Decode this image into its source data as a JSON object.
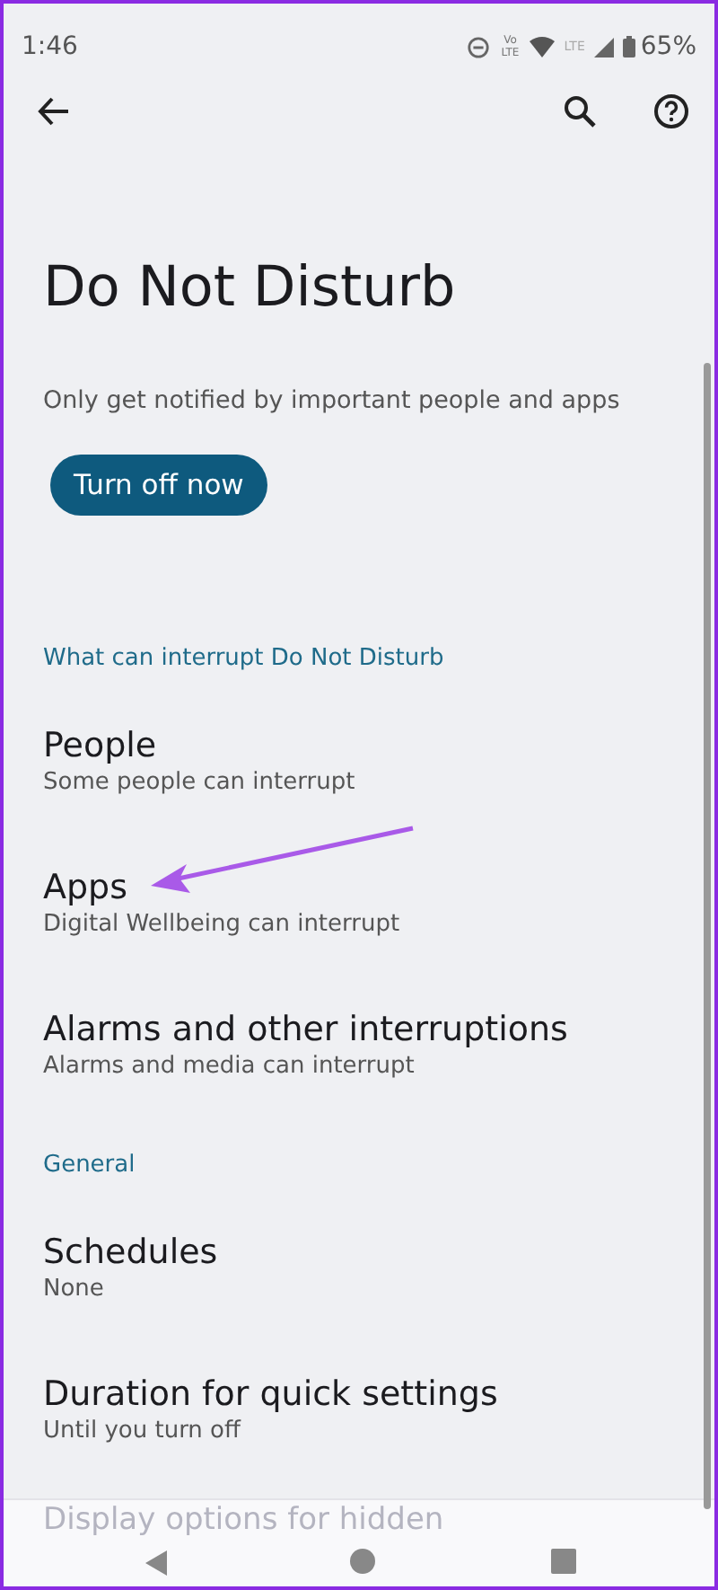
{
  "status_bar": {
    "time": "1:46",
    "network_1": "Vo\nLTE",
    "network_2": "LTE",
    "battery": "65%"
  },
  "title": "Do Not Disturb",
  "description": "Only get notified by important people and apps",
  "action_button": "Turn off now",
  "sections": [
    {
      "header": "What can interrupt Do Not Disturb",
      "items": [
        {
          "title": "People",
          "subtitle": "Some people can interrupt"
        },
        {
          "title": "Apps",
          "subtitle": "Digital Wellbeing can interrupt"
        },
        {
          "title": "Alarms and other interruptions",
          "subtitle": "Alarms and media can interrupt"
        }
      ]
    },
    {
      "header": "General",
      "items": [
        {
          "title": "Schedules",
          "subtitle": "None"
        },
        {
          "title": "Duration for quick settings",
          "subtitle": "Until you turn off"
        }
      ]
    }
  ],
  "hidden_item": "Display options for hidden"
}
